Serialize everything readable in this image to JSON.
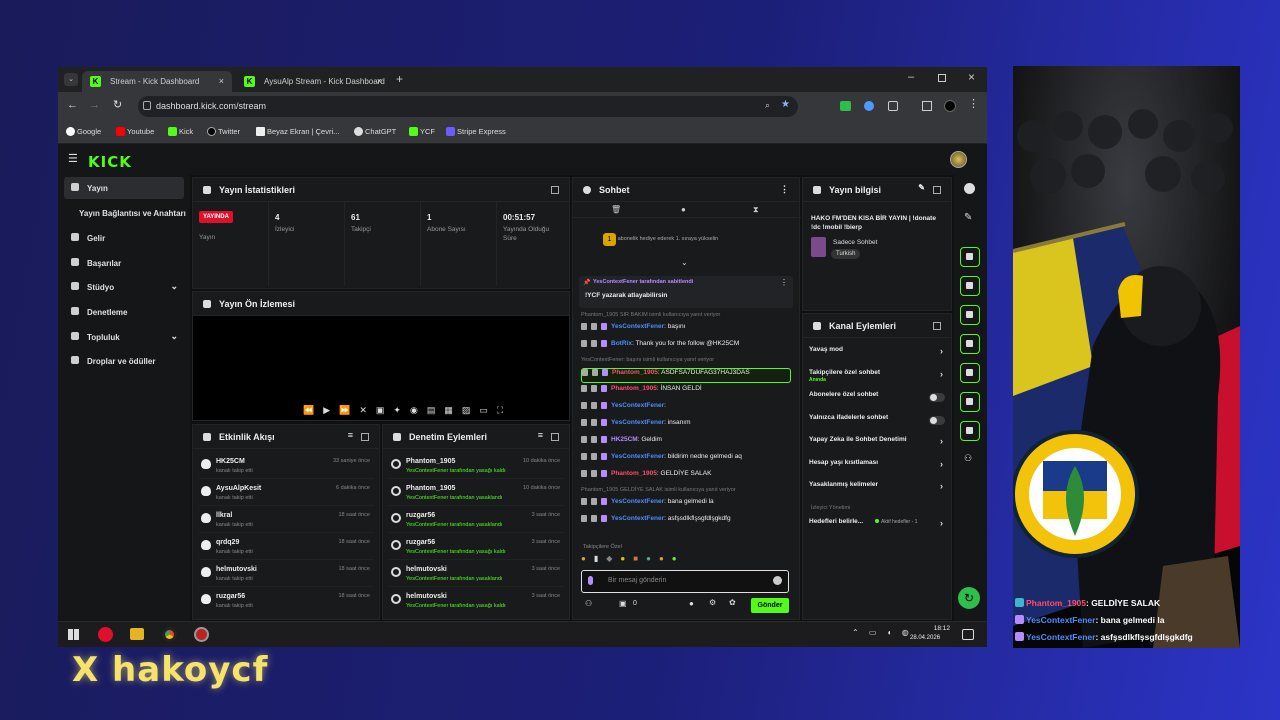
{
  "browser": {
    "tabs": [
      {
        "title": "Stream - Kick Dashboard",
        "active": true
      },
      {
        "title": "AysuAlp Stream - Kick Dashboard",
        "active": false
      }
    ],
    "url": "dashboard.kick.com/stream",
    "bookmarks": [
      "Google",
      "Youtube",
      "Kick",
      "Twitter",
      "Beyaz Ekran | Çevri...",
      "ChatGPT",
      "YCF",
      "Stripe Express"
    ]
  },
  "kick": {
    "logo": "KICK",
    "sidebar": [
      "Yayın",
      "Yayın Bağlantısı ve Anahtarı",
      "Gelir",
      "Başarılar",
      "Stüdyo",
      "Denetleme",
      "Topluluk",
      "Droplar ve ödüller"
    ],
    "stats_title": "Yayın İstatistikleri",
    "stats": {
      "live_badge": "YAYINDA",
      "live_label": "Yayın",
      "viewers": "4",
      "viewers_label": "İzleyici",
      "followers": "61",
      "followers_label": "Takipçi",
      "subs": "1",
      "subs_label": "Abone Sayısı",
      "uptime": "00:51:57",
      "uptime_label1": "Yayında Olduğu",
      "uptime_label2": "Süre"
    },
    "preview_title": "Yayın Ön İzlemesi",
    "activity_title": "Etkinlik Akışı",
    "activity": [
      {
        "name": "HK25CM",
        "sub": "kanalı takip etti",
        "time": "33 saniye önce"
      },
      {
        "name": "AysuAlpKesit",
        "sub": "kanalı takip etti",
        "time": "6 dakika önce"
      },
      {
        "name": "llkral",
        "sub": "kanalı takip etti",
        "time": "18 saat önce"
      },
      {
        "name": "qrdq29",
        "sub": "kanalı takip etti",
        "time": "18 saat önce"
      },
      {
        "name": "helmutovski",
        "sub": "kanalı takip etti",
        "time": "18 saat önce"
      },
      {
        "name": "ruzgar56",
        "sub": "kanalı takip etti",
        "time": "18 saat önce"
      }
    ],
    "modlog_title": "Denetim Eylemleri",
    "modlog": [
      {
        "name": "Phantom_1905",
        "sub": "YesContextFener tarafından yasağı kaldırıldı",
        "time": "10 dakika önce"
      },
      {
        "name": "Phantom_1905",
        "sub": "YesContextFener tarafından yasaklandı",
        "time": "10 dakika önce"
      },
      {
        "name": "ruzgar56",
        "sub": "YesContextFener tarafından yasaklandı",
        "time": "3 saat önce"
      },
      {
        "name": "ruzgar56",
        "sub": "YesContextFener tarafından yasağı kaldırıldı",
        "time": "3 saat önce"
      },
      {
        "name": "helmutovski",
        "sub": "YesContextFener tarafından yasaklandı",
        "time": "3 saat önce"
      },
      {
        "name": "helmutovski",
        "sub": "YesContextFener tarafından yasağı kaldırıldı",
        "time": "3 saat önce"
      }
    ],
    "chat": {
      "title": "Sohbet",
      "gift_banner": "1 abonelik hediye ederek 1. sıraya yükselin",
      "pinned_by": "YesContextFener tarafından sabitlendi",
      "pinned_msg": "!YCF yazarak atlayabilirsin",
      "messages": [
        {
          "sys": "Phantom_1905 SIR BAKIM isimli kullanıcıya yanıt veriyor"
        },
        {
          "user": "YesContextFener",
          "cls": "u-blue",
          "text": "başını"
        },
        {
          "user": "BotRix",
          "cls": "u-blue",
          "text": "Thank you for the follow @HK25CM"
        },
        {
          "sys": "YesContextFener: başını isimli kullanıcıya yanıt veriyor"
        },
        {
          "user": "Phantom_1905",
          "cls": "u-red",
          "text": "ASDFSA7DUFAG37HAJ3DAS",
          "highlight": true
        },
        {
          "user": "Phantom_1905",
          "cls": "u-red",
          "text": "İNSAN GELDİ"
        },
        {
          "user": "YesContextFener",
          "cls": "u-blue",
          "text": ""
        },
        {
          "user": "YesContextFener",
          "cls": "u-blue",
          "text": "insanım"
        },
        {
          "user": "HK25CM",
          "cls": "u-purple",
          "text": "Geldim"
        },
        {
          "user": "YesContextFener",
          "cls": "u-blue",
          "text": "bildirim nedne gelmedi aq"
        },
        {
          "user": "Phantom_1905",
          "cls": "u-red",
          "text": "GELDİYE SALAK"
        },
        {
          "sys": "Phantom_1905 GELDİYE SALAK isimli kullanıcıya yanıt veriyor"
        },
        {
          "user": "YesContextFener",
          "cls": "u-blue",
          "text": "bana gelmedi la"
        },
        {
          "user": "YesContextFener",
          "cls": "u-blue",
          "text": "asfşsdlkflşsgfdlşgkdfg"
        }
      ],
      "followers_only": "Takipçilere Özel",
      "input_placeholder": "Bir mesaj gönderin",
      "counter": "0",
      "send": "Gönder"
    },
    "info": {
      "title": "Yayın bilgisi",
      "stream_title": "HAKO FM'DEN KISA BİR YAYIN | !donate !dc !mobil !bierp",
      "category": "Sadece Sohbet",
      "tag": "Turkish"
    },
    "channel_actions": {
      "title": "Kanal Eylemleri",
      "items": [
        {
          "label": "Yavaş mod",
          "kind": "chev"
        },
        {
          "label": "Takipçilere özel sohbet",
          "sub": "Anında",
          "kind": "chev"
        },
        {
          "label": "Abonelere özel sohbet",
          "kind": "toggle"
        },
        {
          "label": "Yalnızca ifadelerle sohbet",
          "kind": "toggle"
        },
        {
          "label": "Yapay Zeka ile Sohbet Denetimi",
          "kind": "chev"
        },
        {
          "label": "Hesap yaşı kısıtlaması",
          "kind": "chev"
        },
        {
          "label": "Yasaklanmış kelimeler",
          "kind": "chev"
        }
      ],
      "viewer_mgmt": "İzleyici Yönetimi",
      "goals": "Hedefleri belirle...",
      "goals_status": "Aktif hedefler - 1"
    }
  },
  "taskbar": {
    "time": "18:12",
    "date": "28.04.2026"
  },
  "overlay": [
    {
      "user": "Phantom_1905",
      "color": "#ff4d6a",
      "text": ": GELDİYE SALAK"
    },
    {
      "user": "YesContextFener",
      "color": "#4f8bff",
      "text": ": bana gelmedi la"
    },
    {
      "user": "YesContextFener",
      "color": "#4f8bff",
      "text": ": asfşsdlkflşsgfdlşgkdfg"
    }
  ],
  "handle": "X  hakoycf",
  "colors": {
    "kick_green": "#53fc18",
    "bg": "#1c1f78",
    "live_red": "#e0102c"
  }
}
